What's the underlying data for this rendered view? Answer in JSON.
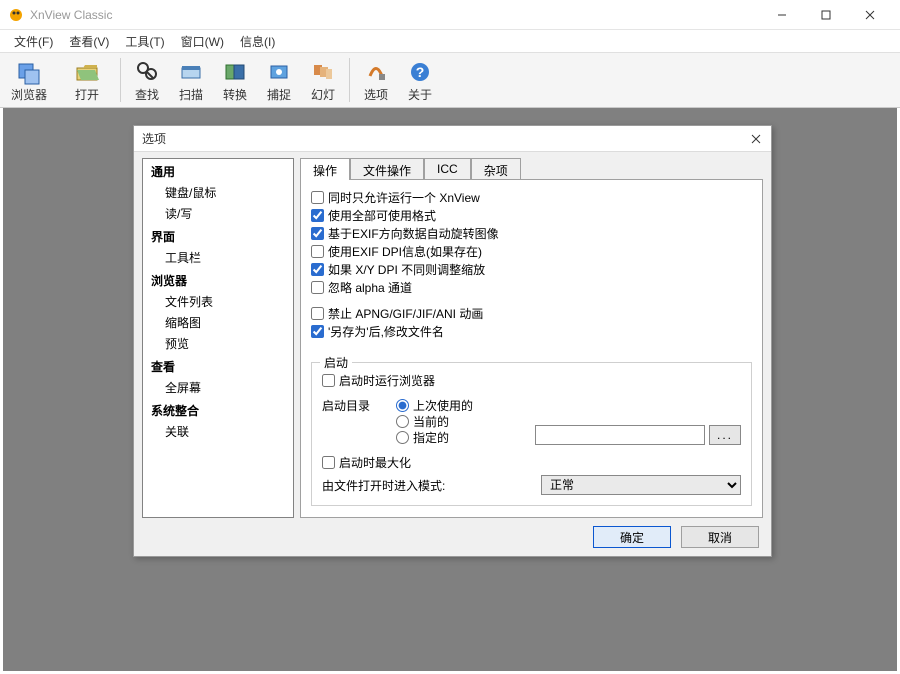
{
  "window": {
    "title": "XnView Classic"
  },
  "menubar": [
    "文件(F)",
    "查看(V)",
    "工具(T)",
    "窗口(W)",
    "信息(I)"
  ],
  "toolbar": [
    {
      "label": "浏览器",
      "big": true
    },
    {
      "label": "打开",
      "big": true
    },
    {
      "sep": true
    },
    {
      "label": "查找"
    },
    {
      "label": "扫描"
    },
    {
      "label": "转换"
    },
    {
      "label": "捕捉"
    },
    {
      "label": "幻灯"
    },
    {
      "sep": true
    },
    {
      "label": "选项"
    },
    {
      "label": "关于"
    }
  ],
  "dialog": {
    "title": "选项",
    "tree": [
      {
        "label": "通用",
        "bold": true
      },
      {
        "label": "键盘/鼠标",
        "sub": true
      },
      {
        "label": "读/写",
        "sub": true
      },
      {
        "label": "界面",
        "bold": true
      },
      {
        "label": "工具栏",
        "sub": true
      },
      {
        "label": "浏览器",
        "bold": true
      },
      {
        "label": "文件列表",
        "sub": true
      },
      {
        "label": "缩略图",
        "sub": true
      },
      {
        "label": "预览",
        "sub": true
      },
      {
        "label": "查看",
        "bold": true
      },
      {
        "label": "全屏幕",
        "sub": true
      },
      {
        "label": "系统整合",
        "bold": true
      },
      {
        "label": "关联",
        "sub": true
      }
    ],
    "tabs": [
      "操作",
      "文件操作",
      "ICC",
      "杂项"
    ],
    "active_tab": 0,
    "checks": [
      {
        "label": "同时只允许运行一个 XnView",
        "checked": false
      },
      {
        "label": "使用全部可使用格式",
        "checked": true
      },
      {
        "label": "基于EXIF方向数据自动旋转图像",
        "checked": true
      },
      {
        "label": "使用EXIF DPI信息(如果存在)",
        "checked": false
      },
      {
        "label": "如果 X/Y DPI 不同则调整缩放",
        "checked": true
      },
      {
        "label": "忽略 alpha 通道",
        "checked": false
      }
    ],
    "checks2": [
      {
        "label": "禁止 APNG/GIF/JIF/ANI 动画",
        "checked": false
      },
      {
        "label": "'另存为'后,修改文件名",
        "checked": true
      }
    ],
    "startup": {
      "legend": "启动",
      "run_browser": {
        "label": "启动时运行浏览器",
        "checked": false
      },
      "dir_label": "启动目录",
      "radios": [
        "上次使用的",
        "当前的",
        "指定的"
      ],
      "radio_sel": 0,
      "browse": "...",
      "maximize": {
        "label": "启动时最大化",
        "checked": false
      },
      "open_mode_label": "由文件打开时进入模式:",
      "open_mode_value": "正常"
    },
    "buttons": {
      "ok": "确定",
      "cancel": "取消"
    }
  }
}
